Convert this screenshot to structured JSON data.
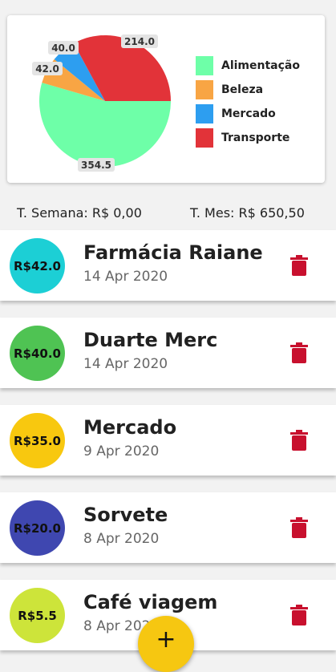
{
  "chart_data": {
    "type": "pie",
    "categories": [
      "Alimentação",
      "Beleza",
      "Mercado",
      "Transporte"
    ],
    "values": [
      354.5,
      42.0,
      40.0,
      214.0
    ],
    "value_labels": [
      "354.5",
      "42.0",
      "40.0",
      "214.0"
    ],
    "colors": [
      "#6effa8",
      "#f8a544",
      "#2d9ef0",
      "#e23339"
    ],
    "legend_position": "right"
  },
  "totals": {
    "week": "T. Semana: R$ 0,00",
    "month": "T. Mes: R$ 650,50"
  },
  "expenses": [
    {
      "amount": "R$42.0",
      "title": "Farmácia Raiane",
      "date": "14 Apr 2020",
      "color": "#1ccfd5"
    },
    {
      "amount": "R$40.0",
      "title": "Duarte Merc",
      "date": "14 Apr 2020",
      "color": "#4fc353"
    },
    {
      "amount": "R$35.0",
      "title": "Mercado",
      "date": "9 Apr 2020",
      "color": "#f8c80f"
    },
    {
      "amount": "R$20.0",
      "title": "Sorvete",
      "date": "8 Apr 2020",
      "color": "#3f47b0"
    },
    {
      "amount": "R$5.5",
      "title": "Café viagem",
      "date": "8 Apr 2020",
      "color": "#cde43a"
    }
  ],
  "icons": {
    "delete": "trash-icon",
    "add": "plus-icon"
  },
  "fab": {
    "label": "+"
  }
}
